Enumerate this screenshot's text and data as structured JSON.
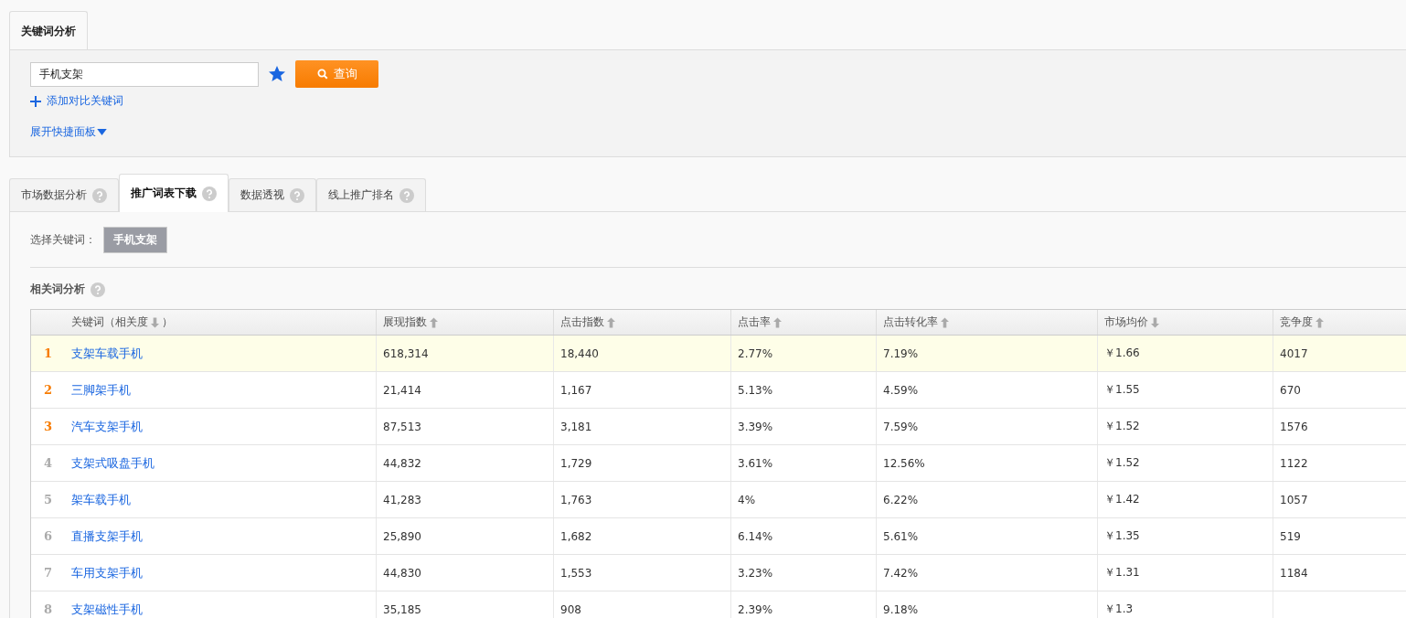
{
  "top_tab": {
    "label": "关键词分析"
  },
  "search": {
    "value": "手机支架",
    "button": "查询",
    "favorite": true
  },
  "add_compare": "添加对比关键词",
  "expand_panel": "展开快捷面板",
  "tabs": [
    {
      "label": "市场数据分析",
      "selected": false
    },
    {
      "label": "推广词表下载",
      "selected": true
    },
    {
      "label": "数据透视",
      "selected": false
    },
    {
      "label": "线上推广排名",
      "selected": false
    }
  ],
  "keyword_select": {
    "label": "选择关键词：",
    "chip": "手机支架"
  },
  "section_title": "相关词分析",
  "table": {
    "columns": [
      {
        "label": "关键词（相关度",
        "descending": true,
        "suffix": "）"
      },
      {
        "label": "展现指数",
        "descending": false
      },
      {
        "label": "点击指数",
        "descending": false
      },
      {
        "label": "点击率",
        "descending": false
      },
      {
        "label": "点击转化率",
        "descending": false
      },
      {
        "label": "市场均价",
        "descending": true
      },
      {
        "label": "竞争度",
        "descending": false
      }
    ],
    "rows": [
      {
        "rank": "1",
        "top": true,
        "selected": true,
        "cells": [
          "支架车载手机",
          "618,314",
          "18,440",
          "2.77%",
          "7.19%",
          "￥1.66",
          "4017"
        ]
      },
      {
        "rank": "2",
        "top": true,
        "selected": false,
        "cells": [
          "三脚架手机",
          "21,414",
          "1,167",
          "5.13%",
          "4.59%",
          "￥1.55",
          "670"
        ]
      },
      {
        "rank": "3",
        "top": true,
        "selected": false,
        "cells": [
          "汽车支架手机",
          "87,513",
          "3,181",
          "3.39%",
          "7.59%",
          "￥1.52",
          "1576"
        ]
      },
      {
        "rank": "4",
        "top": false,
        "selected": false,
        "cells": [
          "支架式吸盘手机",
          "44,832",
          "1,729",
          "3.61%",
          "12.56%",
          "￥1.52",
          "1122"
        ]
      },
      {
        "rank": "5",
        "top": false,
        "selected": false,
        "cells": [
          "架车载手机",
          "41,283",
          "1,763",
          "4%",
          "6.22%",
          "￥1.42",
          "1057"
        ]
      },
      {
        "rank": "6",
        "top": false,
        "selected": false,
        "cells": [
          "直播支架手机",
          "25,890",
          "1,682",
          "6.14%",
          "5.61%",
          "￥1.35",
          "519"
        ]
      },
      {
        "rank": "7",
        "top": false,
        "selected": false,
        "cells": [
          "车用支架手机",
          "44,830",
          "1,553",
          "3.23%",
          "7.42%",
          "￥1.31",
          "1184"
        ]
      },
      {
        "rank": "8",
        "top": false,
        "selected": false,
        "cells": [
          "支架磁性手机",
          "35,185",
          "908",
          "2.39%",
          "9.18%",
          "￥1.3"
        ]
      }
    ]
  }
}
